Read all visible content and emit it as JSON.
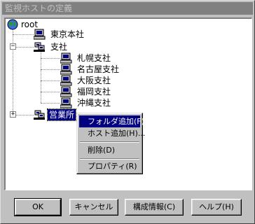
{
  "window": {
    "title": "監視ホストの定義"
  },
  "tree": {
    "root": "root",
    "nodes": [
      {
        "label": "東京本社"
      },
      {
        "label": "支社",
        "expander": "−"
      },
      {
        "label": "札幌支社"
      },
      {
        "label": "名古屋支社"
      },
      {
        "label": "大阪支社"
      },
      {
        "label": "福岡支社"
      },
      {
        "label": "沖縄支社"
      },
      {
        "label": "営業所",
        "expander": "+"
      }
    ]
  },
  "context_menu": {
    "items": [
      {
        "label": "フォルダ追加(F)..."
      },
      {
        "label": "ホスト追加(H)..."
      },
      {
        "label": "削除(D)"
      },
      {
        "label": "プロパティ(R)"
      }
    ]
  },
  "buttons": {
    "ok": "OK",
    "cancel": "キャンセル",
    "config": "構成情報(C)",
    "help": "ヘルプ(H)"
  },
  "colors": {
    "selection": "#000080",
    "dialog_bg": "#c0c0c0",
    "titlebar_inactive": "#808080"
  }
}
